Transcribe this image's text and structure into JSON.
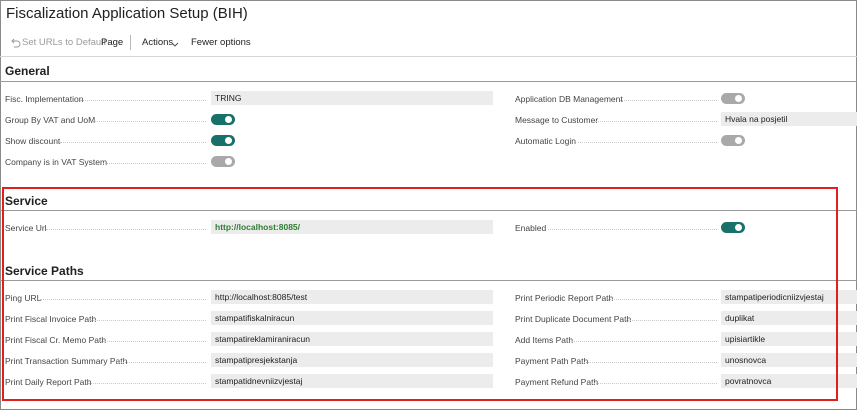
{
  "page": {
    "title": "Fiscalization Application Setup (BIH)"
  },
  "toolbar": {
    "set_urls_label": "Set URLs to Default",
    "page_label": "Page",
    "actions_label": "Actions",
    "fewer_options_label": "Fewer options"
  },
  "general": {
    "title": "General",
    "fisc_impl_label": "Fisc. Implementation",
    "fisc_impl_value": "TRING",
    "group_vat_label": "Group By VAT and UoM",
    "group_vat_on": true,
    "show_discount_label": "Show discount",
    "show_discount_on": true,
    "vat_system_label": "Company is in VAT System",
    "vat_system_on": false,
    "app_db_label": "Application DB Management",
    "app_db_on": false,
    "message_label": "Message to Customer",
    "message_value": "Hvala na posjetil",
    "auto_login_label": "Automatic Login",
    "auto_login_on": false
  },
  "service": {
    "title": "Service",
    "url_label": "Service Url",
    "url_value": "http://localhost:8085/",
    "enabled_label": "Enabled",
    "enabled_on": true
  },
  "service_paths": {
    "title": "Service Paths",
    "ping_label": "Ping URL",
    "ping_value": "http://localhost:8085/test",
    "fiscal_invoice_label": "Print Fiscal Invoice Path",
    "fiscal_invoice_value": "stampatifiskalniracun",
    "cr_memo_label": "Print Fiscal Cr. Memo Path",
    "cr_memo_value": "stampatireklamiraniracun",
    "trans_summary_label": "Print Transaction Summary Path",
    "trans_summary_value": "stampatipresjekstanja",
    "daily_report_label": "Print Daily Report Path",
    "daily_report_value": "stampatidnevniizvjestaj",
    "periodic_label": "Print Periodic Report Path",
    "periodic_value": "stampatiperiodicniizvjestaj",
    "duplicate_label": "Print Duplicate Document Path",
    "duplicate_value": "duplikat",
    "add_items_label": "Add Items Path",
    "add_items_value": "upisiartikle",
    "payment_label": "Payment Path Path",
    "payment_value": "unosnovca",
    "refund_label": "Payment Refund Path",
    "refund_value": "povratnovca"
  },
  "colors": {
    "toggle_on": "#18706a",
    "toggle_off": "#a9a9a9",
    "highlight_border": "#e02020",
    "link_value": "#2e7d32"
  }
}
